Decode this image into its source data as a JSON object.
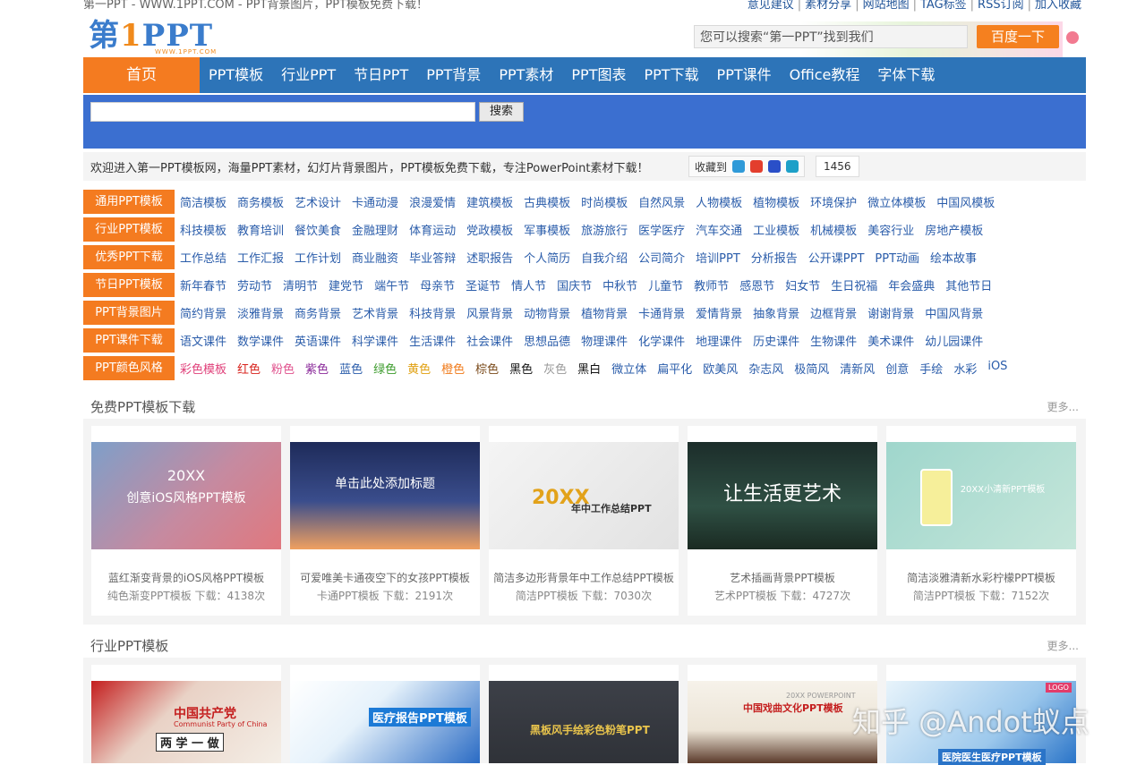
{
  "topbar": {
    "site_line": "第一PPT - WWW.1PPT.COM - PPT背景图片，PPT模板免费下载！",
    "links": [
      "意见建议",
      "素材分享",
      "网站地图",
      "TAG标签",
      "RSS订阅",
      "加入收藏"
    ]
  },
  "logo": {
    "main_a": "第",
    "main_b": "1",
    "main_c": "PPT",
    "sub": "WWW.1PPT.COM"
  },
  "header_search": {
    "placeholder": "您可以搜索“第一PPT”找到我们",
    "button": "百度一下"
  },
  "nav": {
    "home": "首页",
    "items": [
      "PPT模板",
      "行业PPT",
      "节日PPT",
      "PPT背景",
      "PPT素材",
      "PPT图表",
      "PPT下载",
      "PPT课件",
      "Office教程",
      "字体下载"
    ]
  },
  "site_search": {
    "button": "搜索"
  },
  "welcome": {
    "message": "欢迎进入第一PPT模板网，海量PPT素材，幻灯片背景图片，PPT模板免费下载，专注PowerPoint素材下载！",
    "fav_label": "收藏到",
    "count": "1456"
  },
  "categories": [
    {
      "label": "通用PPT模板",
      "links": [
        "简洁模板",
        "商务模板",
        "艺术设计",
        "卡通动漫",
        "浪漫爱情",
        "建筑模板",
        "古典模板",
        "时尚模板",
        "自然风景",
        "人物模板",
        "植物模板",
        "环境保护",
        "微立体模板",
        "中国风模板"
      ]
    },
    {
      "label": "行业PPT模板",
      "links": [
        "科技模板",
        "教育培训",
        "餐饮美食",
        "金融理财",
        "体育运动",
        "党政模板",
        "军事模板",
        "旅游旅行",
        "医学医疗",
        "汽车交通",
        "工业模板",
        "机械模板",
        "美容行业",
        "房地产模板"
      ]
    },
    {
      "label": "优秀PPT下载",
      "links": [
        "工作总结",
        "工作汇报",
        "工作计划",
        "商业融资",
        "毕业答辩",
        "述职报告",
        "个人简历",
        "自我介绍",
        "公司简介",
        "培训PPT",
        "分析报告",
        "公开课PPT",
        "PPT动画",
        "绘本故事"
      ]
    },
    {
      "label": "节日PPT模板",
      "links": [
        "新年春节",
        "劳动节",
        "清明节",
        "建党节",
        "端午节",
        "母亲节",
        "圣诞节",
        "情人节",
        "国庆节",
        "中秋节",
        "儿童节",
        "教师节",
        "感恩节",
        "妇女节",
        "生日祝福",
        "年会盛典",
        "其他节日"
      ]
    },
    {
      "label": "PPT背景图片",
      "links": [
        "简约背景",
        "淡雅背景",
        "商务背景",
        "艺术背景",
        "科技背景",
        "风景背景",
        "动物背景",
        "植物背景",
        "卡通背景",
        "爱情背景",
        "抽象背景",
        "边框背景",
        "谢谢背景",
        "中国风背景"
      ]
    },
    {
      "label": "PPT课件下载",
      "links": [
        "语文课件",
        "数学课件",
        "英语课件",
        "科学课件",
        "生活课件",
        "社会课件",
        "思想品德",
        "物理课件",
        "化学课件",
        "地理课件",
        "历史课件",
        "生物课件",
        "美术课件",
        "幼儿园课件"
      ]
    },
    {
      "label": "PPT颜色风格",
      "links": [
        "彩色模板",
        "红色",
        "粉色",
        "紫色",
        "蓝色",
        "绿色",
        "黄色",
        "橙色",
        "棕色",
        "黑色",
        "灰色",
        "黑白",
        "微立体",
        "扁平化",
        "欧美风",
        "杂志风",
        "极简风",
        "清新风",
        "创意",
        "手绘",
        "水彩",
        "iOS"
      ]
    }
  ],
  "color_style_colors": [
    "#e0407a",
    "#d8231d",
    "#e0508c",
    "#8a2a9a",
    "#2a5caa",
    "#3a9a2a",
    "#e0a010",
    "#f07a1a",
    "#7a4a1a",
    "#111111",
    "#999999",
    "#111111"
  ],
  "section_free": {
    "title": "免费PPT模板下载",
    "more": "更多..."
  },
  "free_cards": [
    {
      "title": "蓝红渐变背景的iOS风格PPT模板",
      "meta": "纯色渐变PPT模板  下载：4138次",
      "thumb_text": "创意iOS风格PPT模板",
      "thumb_top": "20XX"
    },
    {
      "title": "可爱唯美卡通夜空下的女孩PPT模板",
      "meta": "卡通PPT模板  下载：2191次",
      "thumb_text": "单击此处添加标题",
      "thumb_top": ""
    },
    {
      "title": "简洁多边形背景年中工作总结PPT模板",
      "meta": "简洁PPT模板  下载：7030次",
      "thumb_text": "年中工作总结PPT",
      "thumb_top": "20XX"
    },
    {
      "title": "艺术插画背景PPT模板",
      "meta": "艺术PPT模板  下载：4727次",
      "thumb_text": "让生活更艺术",
      "thumb_top": ""
    },
    {
      "title": "简洁淡雅清新水彩柠檬PPT模板",
      "meta": "简洁PPT模板  下载：7152次",
      "thumb_text": "20XX小清新PPT模板",
      "thumb_top": ""
    }
  ],
  "section_industry": {
    "title": "行业PPT模板",
    "more": "更多..."
  },
  "industry_cards": [
    {
      "thumb_text": "中国共产党",
      "thumb_sub": "Communist Party of China",
      "thumb_extra": "两 学 一 做"
    },
    {
      "thumb_text": "医疗报告PPT模板",
      "thumb_sub": "",
      "thumb_extra": ""
    },
    {
      "thumb_text": "黑板风手绘彩色粉笔PPT",
      "thumb_sub": "",
      "thumb_extra": ""
    },
    {
      "thumb_text": "中国戏曲文化PPT模板",
      "thumb_sub": "20XX POWERPOINT",
      "thumb_extra": ""
    },
    {
      "thumb_text": "医院医生医疗PPT模板",
      "thumb_sub": "LOGO",
      "thumb_extra": ""
    }
  ],
  "watermark": "知乎 @Andot蚁点"
}
